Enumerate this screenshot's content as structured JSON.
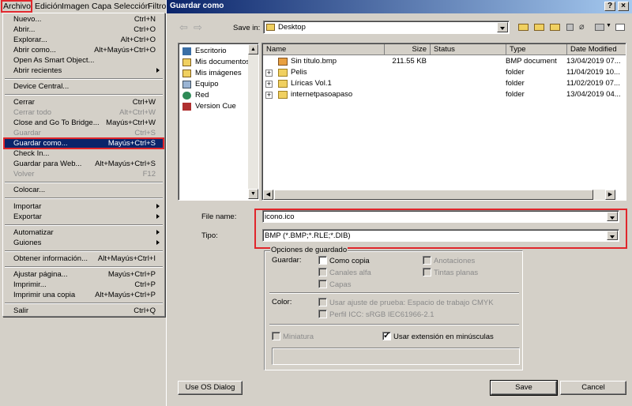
{
  "menubar": [
    "Archivo",
    "Edición",
    "Imagen",
    "Capa",
    "Selección",
    "Filtro"
  ],
  "menu": {
    "items": [
      {
        "label": "Nuevo...",
        "shortcut": "Ctrl+N"
      },
      {
        "label": "Abrir...",
        "shortcut": "Ctrl+O"
      },
      {
        "label": "Explorar...",
        "shortcut": "Alt+Ctrl+O"
      },
      {
        "label": "Abrir como...",
        "shortcut": "Alt+Mayús+Ctrl+O"
      },
      {
        "label": "Open As Smart Object...",
        "shortcut": ""
      },
      {
        "label": "Abrir recientes",
        "shortcut": ""
      },
      {
        "label": "Device Central...",
        "shortcut": ""
      },
      {
        "label": "Cerrar",
        "shortcut": "Ctrl+W"
      },
      {
        "label": "Cerrar todo",
        "shortcut": "Alt+Ctrl+W"
      },
      {
        "label": "Close and Go To Bridge...",
        "shortcut": "Mayús+Ctrl+W"
      },
      {
        "label": "Guardar",
        "shortcut": "Ctrl+S"
      },
      {
        "label": "Guardar como...",
        "shortcut": "Mayús+Ctrl+S"
      },
      {
        "label": "Check In...",
        "shortcut": ""
      },
      {
        "label": "Guardar para Web...",
        "shortcut": "Alt+Mayús+Ctrl+S"
      },
      {
        "label": "Volver",
        "shortcut": "F12"
      },
      {
        "label": "Colocar...",
        "shortcut": ""
      },
      {
        "label": "Importar",
        "shortcut": ""
      },
      {
        "label": "Exportar",
        "shortcut": ""
      },
      {
        "label": "Automatizar",
        "shortcut": ""
      },
      {
        "label": "Guiones",
        "shortcut": ""
      },
      {
        "label": "Obtener información...",
        "shortcut": "Alt+Mayús+Ctrl+I"
      },
      {
        "label": "Ajustar página...",
        "shortcut": "Mayús+Ctrl+P"
      },
      {
        "label": "Imprimir...",
        "shortcut": "Ctrl+P"
      },
      {
        "label": "Imprimir una copia",
        "shortcut": "Alt+Mayús+Ctrl+P"
      },
      {
        "label": "Salir",
        "shortcut": "Ctrl+Q"
      }
    ]
  },
  "dialog": {
    "title": "Guardar como",
    "help_glyph": "?",
    "close_glyph": "×",
    "save_in_label": "Save in:",
    "save_in_value": "Desktop",
    "places": [
      "Escritorio",
      "Mis documentos",
      "Mis imágenes",
      "Equipo",
      "Red",
      "Version Cue"
    ],
    "columns": [
      "Name",
      "Size",
      "Status",
      "Type",
      "Date Modified"
    ],
    "files": [
      {
        "name": "Sin título.bmp",
        "size": "211.55 KB",
        "status": "",
        "type": "BMP document",
        "date": "13/04/2019 07..."
      },
      {
        "name": "Pelis",
        "size": "",
        "status": "",
        "type": "folder",
        "date": "11/04/2019 10..."
      },
      {
        "name": "Líricas Vol.1",
        "size": "",
        "status": "",
        "type": "folder",
        "date": "11/02/2019 07..."
      },
      {
        "name": "internetpasoapaso",
        "size": "",
        "status": "",
        "type": "folder",
        "date": "13/04/2019 04..."
      }
    ],
    "file_name_label": "File name:",
    "file_name_value": "icono.ico",
    "type_label": "Tipo:",
    "type_value": "BMP (*.BMP;*.RLE;*.DIB)",
    "options_title": "Opciones de guardado",
    "guardar_label": "Guardar:",
    "opts": {
      "como_copia": "Como copia",
      "anotaciones": "Anotaciones",
      "canales_alfa": "Canales alfa",
      "tintas_planas": "Tintas planas",
      "capas": "Capas"
    },
    "color_label": "Color:",
    "color_opts": {
      "ajuste": "Usar ajuste de prueba: Espacio de trabajo CMYK",
      "perfil": "Perfil ICC: sRGB IEC61966-2.1"
    },
    "miniatura": "Miniatura",
    "minusculas": "Usar extensión en minúsculas",
    "use_os_dialog": "Use OS Dialog",
    "save_button": "Save",
    "cancel_button": "Cancel"
  }
}
